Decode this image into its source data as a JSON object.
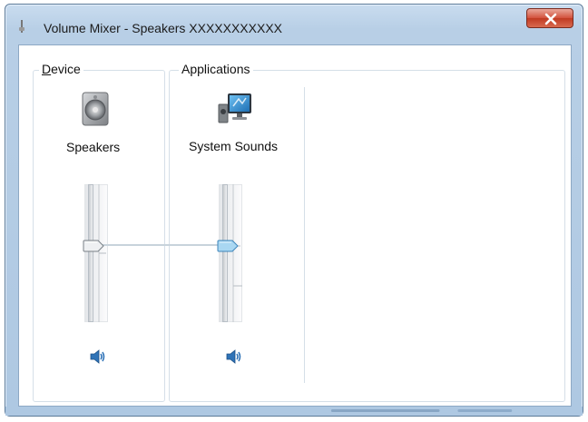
{
  "window": {
    "title": "Volume Mixer - Speakers  XXXXXXXXXXX",
    "close_glyph": "×",
    "icon": "speaker-icon"
  },
  "device_group": {
    "label": "Device",
    "device": {
      "name": "Speakers",
      "icon": "speaker-device-icon",
      "volume": 0.55,
      "mute_icon": "speaker-volume-icon"
    }
  },
  "apps_group": {
    "label": "Applications",
    "apps": [
      {
        "name": "System Sounds",
        "icon": "system-sounds-icon",
        "volume": 0.55,
        "mute_icon": "speaker-volume-icon"
      }
    ]
  },
  "colors": {
    "accent": "#5aa9de",
    "frame": "#aec8e2",
    "close": "#c8432b"
  }
}
